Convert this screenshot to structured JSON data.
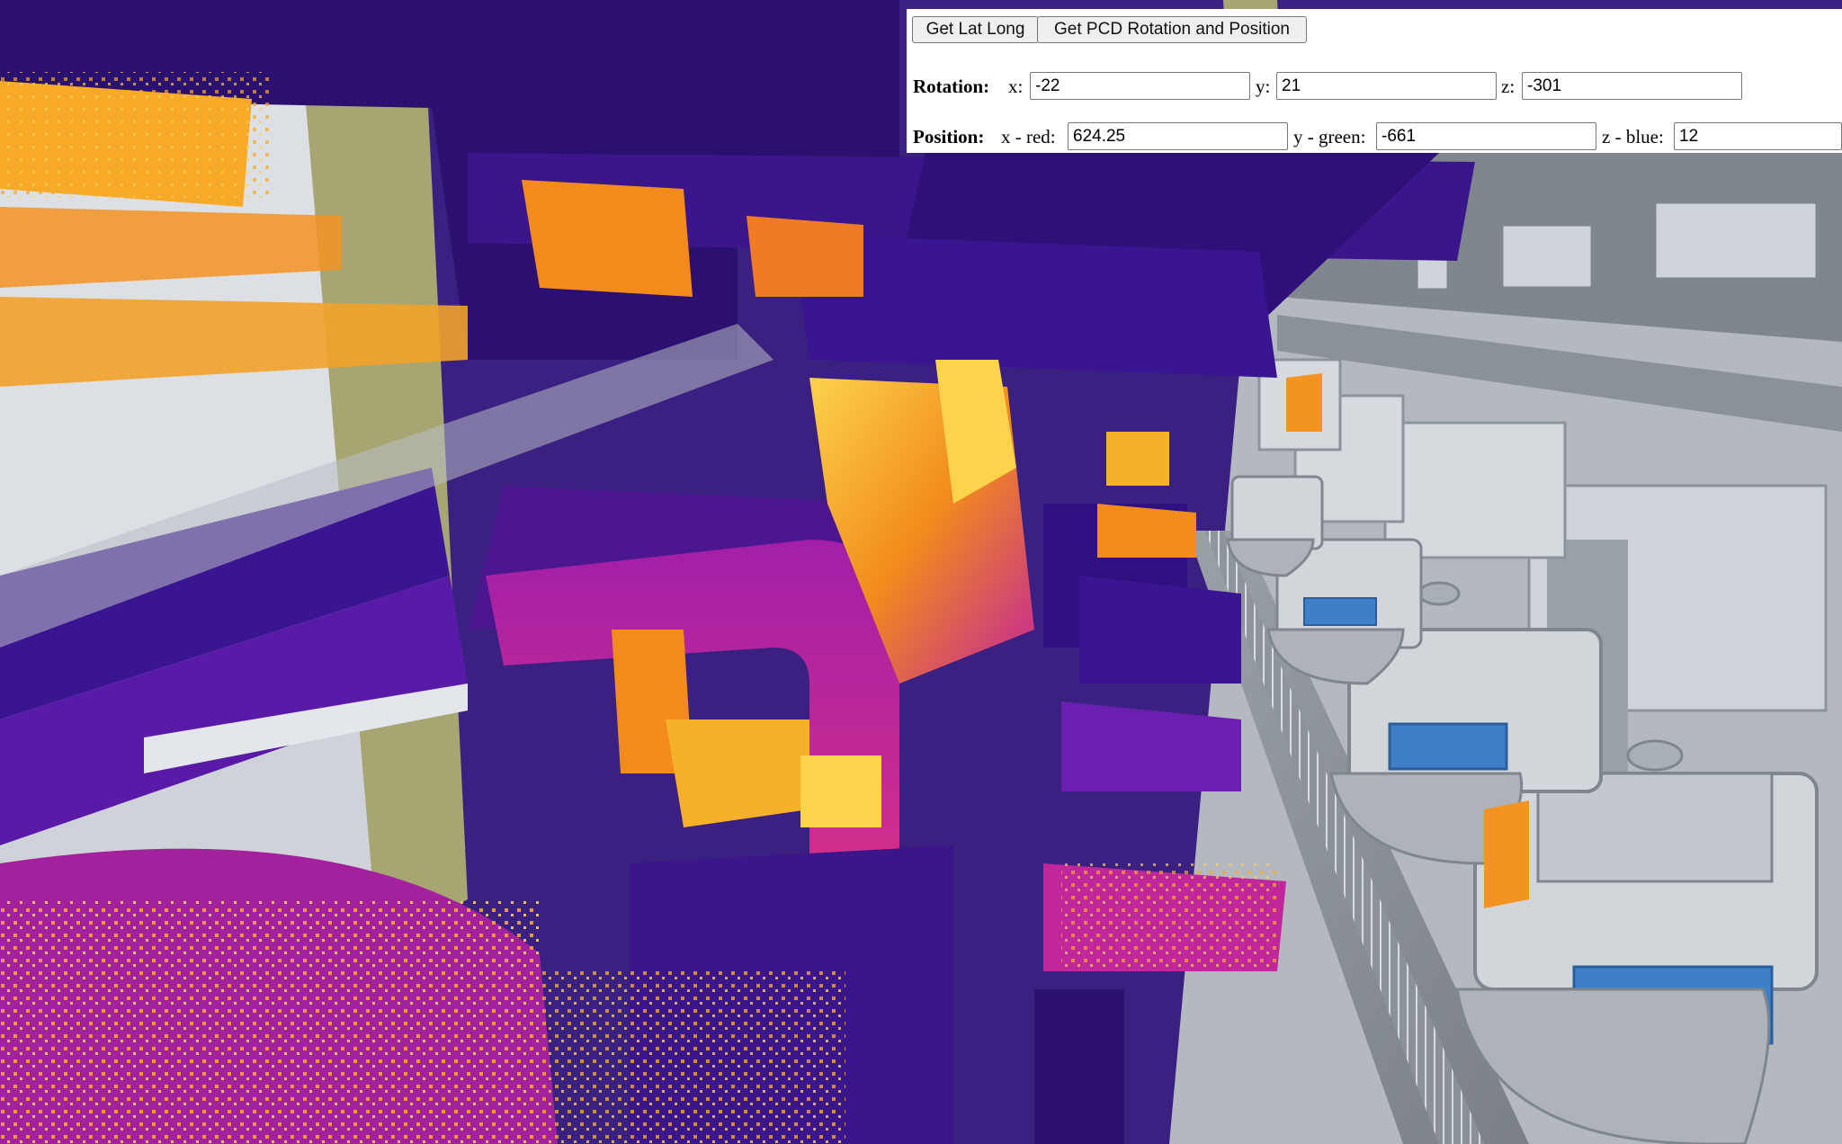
{
  "toolbar": {
    "get_lat_long_label": "Get Lat Long",
    "get_pcd_label": "Get PCD Rotation and Position"
  },
  "rotation": {
    "heading": "Rotation:",
    "x_label": "x:",
    "x_value": "-22",
    "y_label": "y:",
    "y_value": "21",
    "z_label": "z:",
    "z_value": "-301"
  },
  "position": {
    "heading": "Position:",
    "x_label": "x - red:",
    "x_value": "624.25",
    "y_label": "y - green:",
    "y_value": "-661",
    "z_label": "z - blue:",
    "z_value": "12"
  },
  "scene": {
    "description_colors": {
      "pointcloud_dark": "#2b1070",
      "pointcloud_purple": "#6a1fb0",
      "pointcloud_magenta": "#c2249c",
      "pointcloud_orange": "#f28b1c",
      "pointcloud_yellow": "#fcd34a",
      "model_gray": "#b6bcc4",
      "model_light": "#d9dde2",
      "model_olive": "#a7a673",
      "model_blue": "#3d7fc8"
    }
  }
}
